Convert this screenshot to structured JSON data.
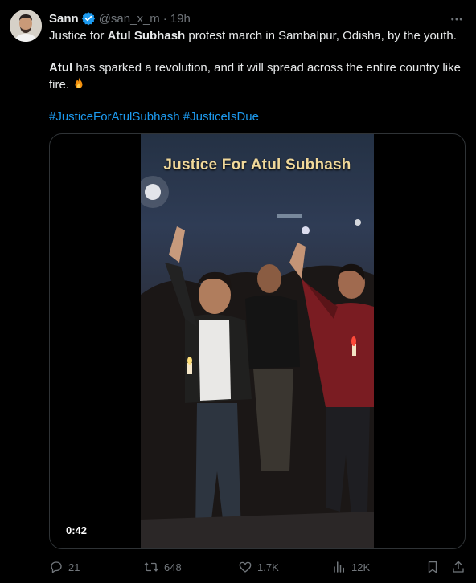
{
  "author": {
    "name": "Sann",
    "handle": "@san_x_m",
    "separator": "·",
    "time": "19h",
    "verified": true
  },
  "tweet": {
    "line1_pre": "Justice for ",
    "line1_bold": "Atul Subhash",
    "line1_post": " protest march in Sambalpur, Odisha, by the youth.",
    "line2_bold": "Atul",
    "line2_post": " has sparked a revolution, and it will spread across the entire country like fire.",
    "hashtag1": "#JusticeForAtulSubhash",
    "hashtag2": "#JusticeIsDue",
    "emoji": "fire-icon"
  },
  "media": {
    "caption": "Justice For Atul Subhash",
    "duration": "0:42"
  },
  "actions": {
    "replies": "21",
    "reposts": "648",
    "likes": "1.7K",
    "views": "12K"
  },
  "colors": {
    "background": "#000000",
    "text": "#e7e9ea",
    "muted": "#71767b",
    "link": "#1d9bf0",
    "verified": "#1d9bf0",
    "border": "#2f3336"
  }
}
